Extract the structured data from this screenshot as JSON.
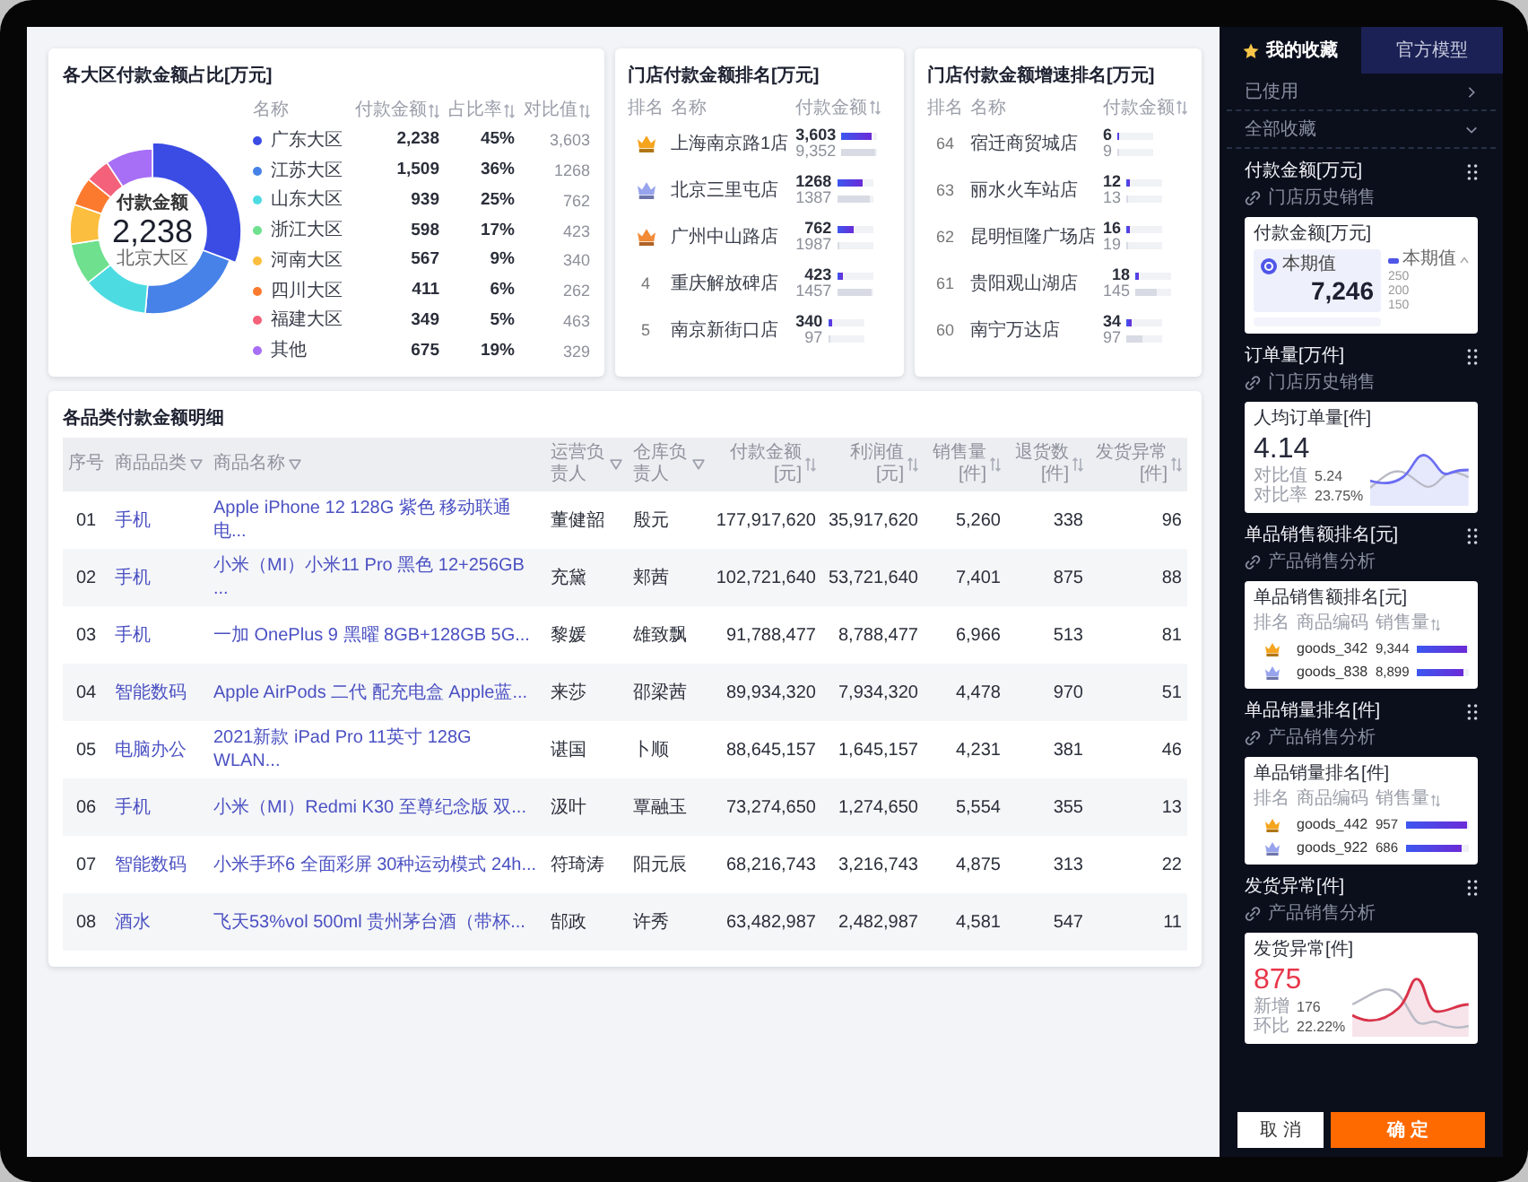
{
  "region_share": {
    "title": "各大区付款金额占比[万元]",
    "center": {
      "label": "付款金额",
      "value": "2,238",
      "caption": "北京大区"
    },
    "columns": [
      {
        "label": "名称",
        "sortable": false
      },
      {
        "label": "付款金额",
        "sortable": true
      },
      {
        "label": "占比率",
        "sortable": true
      },
      {
        "label": "对比值",
        "sortable": true
      }
    ],
    "rows": [
      {
        "color": "#3b4ce4",
        "amount": "2,238",
        "share": "45%",
        "compare": "3,603"
      },
      {
        "color": "#4682e8",
        "amount": "1,509",
        "share": "36%",
        "compare": "1268"
      },
      {
        "color": "#4ddbe2",
        "amount": "939",
        "share": "25%",
        "compare": "762"
      },
      {
        "color": "#6ee08e",
        "amount": "598",
        "share": "17%",
        "compare": "423"
      },
      {
        "color": "#fcbe3e",
        "amount": "567",
        "share": "9%",
        "compare": "340"
      },
      {
        "color": "#fb7a2e",
        "amount": "411",
        "share": "6%",
        "compare": "262"
      },
      {
        "color": "#f4617a",
        "amount": "349",
        "share": "5%",
        "compare": "463"
      },
      {
        "color": "#a76ef6",
        "amount": "675",
        "share": "19%",
        "compare": "329"
      }
    ],
    "slices": [
      {
        "color": "#3b4ce4",
        "selected": true
      },
      {
        "color": "#4682e8",
        "selected": false
      },
      {
        "color": "#4ddbe2",
        "selected": false
      },
      {
        "color": "#6ee08e",
        "selected": false
      },
      {
        "color": "#fcbe3e",
        "selected": false
      },
      {
        "color": "#fb7a2e",
        "selected": false
      },
      {
        "color": "#f4617a",
        "selected": false
      },
      {
        "color": "#a76ef6",
        "selected": false
      }
    ],
    "chart_data": {
      "type": "donut",
      "categories": [
        "广东大区",
        "江苏大区",
        "山东大区",
        "浙江大区",
        "河南大区",
        "四川大区",
        "福建大区",
        "其他"
      ],
      "values": [
        30.7,
        20.7,
        12.9,
        8.2,
        7.8,
        5.6,
        4.8,
        9.3
      ]
    }
  },
  "store_ranking": {
    "title": "门店付款金额排名[万元]",
    "columns": [
      {
        "label": "排名",
        "sortable": false
      },
      {
        "label": "名称",
        "sortable": false
      },
      {
        "label": "付款金额",
        "sortable": true
      }
    ],
    "rows": [
      {
        "kind": "medal",
        "color": "#f5a41d",
        "name": "上海南京路1店",
        "current": {
          "value": "3,603",
          "level": 0.85
        },
        "compare": {
          "value": "9,352",
          "level": 0.95
        }
      },
      {
        "kind": "medal",
        "color": "#97a3ec",
        "name": "北京三里屯店",
        "current": {
          "value": "1268",
          "level": 0.7
        },
        "compare": {
          "value": "1387",
          "level": 0.9
        }
      },
      {
        "kind": "medal",
        "color": "#f28a36",
        "name": "广州中山路店",
        "current": {
          "value": "762",
          "level": 0.45
        },
        "compare": {
          "value": "1987",
          "level": 0.05
        }
      },
      {
        "kind": "number",
        "rank": "4",
        "name": "重庆解放碑店",
        "current": {
          "value": "423",
          "level": 0.15
        },
        "compare": {
          "value": "1457",
          "level": 0.95
        }
      },
      {
        "kind": "number",
        "rank": "5",
        "name": "南京新街口店",
        "current": {
          "value": "340",
          "level": 0.12
        },
        "compare": {
          "value": "97",
          "level": 0.05
        }
      }
    ]
  },
  "store_growth_ranking": {
    "title": "门店付款金额增速排名[万元]",
    "columns": [
      {
        "label": "排名",
        "sortable": false
      },
      {
        "label": "名称",
        "sortable": false
      },
      {
        "label": "付款金额",
        "sortable": true
      }
    ],
    "rows": [
      {
        "kind": "number",
        "rank": "64",
        "name": "宿迁商贸城店",
        "current": {
          "value": "6",
          "level": 0.05
        },
        "compare": {
          "value": "9",
          "level": 0.04
        }
      },
      {
        "kind": "number",
        "rank": "63",
        "name": "丽水火车站店",
        "current": {
          "value": "12",
          "level": 0.08
        },
        "compare": {
          "value": "13",
          "level": 0.04
        }
      },
      {
        "kind": "number",
        "rank": "62",
        "name": "昆明恒隆广场店",
        "current": {
          "value": "16",
          "level": 0.1
        },
        "compare": {
          "value": "19",
          "level": 0.04
        }
      },
      {
        "kind": "number",
        "rank": "61",
        "name": "贵阳观山湖店",
        "current": {
          "value": "18",
          "level": 0.1
        },
        "compare": {
          "value": "145",
          "level": 0.6
        }
      },
      {
        "kind": "number",
        "rank": "60",
        "name": "南宁万达店",
        "current": {
          "value": "34",
          "level": 0.15
        },
        "compare": {
          "value": "97",
          "level": 0.45
        }
      }
    ]
  },
  "category_detail": {
    "title": "各品类付款金额明细",
    "columns": [
      {
        "label": "序号",
        "kind": "plain",
        "link": false
      },
      {
        "label": "商品品类",
        "kind": "filter",
        "link": true
      },
      {
        "label": "商品名称",
        "kind": "filter",
        "link": true
      },
      {
        "label": "运营负责人",
        "kind": "filter",
        "link": false
      },
      {
        "label": "仓库负责人",
        "kind": "filter",
        "link": false
      },
      {
        "label": "付款金额[元]",
        "kind": "sort",
        "link": false
      },
      {
        "label": "利润值[元]",
        "kind": "sort",
        "link": false
      },
      {
        "label": "销售量[件]",
        "kind": "sort",
        "link": false
      },
      {
        "label": "退货数[件]",
        "kind": "sort",
        "link": false
      },
      {
        "label": "发货异常[件]",
        "kind": "sort",
        "link": false
      }
    ],
    "rows": [
      [
        "01",
        "手机",
        "Apple iPhone 12 128G 紫色 移动联通电...",
        "董健韶",
        "殷元",
        "177,917,620",
        "35,917,620",
        "5,260",
        "338",
        "96"
      ],
      [
        "02",
        "手机",
        "小米（MI）小米11 Pro 黑色 12+256GB ...",
        "充黛",
        "郏茜",
        "102,721,640",
        "53,721,640",
        "7,401",
        "875",
        "88"
      ],
      [
        "03",
        "手机",
        "一加 OnePlus 9 黑曜 8GB+128GB 5G...",
        "黎媛",
        "雄致飘",
        "91,788,477",
        "8,788,477",
        "6,966",
        "513",
        "81"
      ],
      [
        "04",
        "智能数码",
        "Apple AirPods 二代 配充电盒 Apple蓝...",
        "来莎",
        "邵梁茜",
        "89,934,320",
        "7,934,320",
        "4,478",
        "970",
        "51"
      ],
      [
        "05",
        "电脑办公",
        "2021新款 iPad Pro 11英寸 128G WLAN...",
        "谌国",
        "卜顺",
        "88,645,157",
        "1,645,157",
        "4,231",
        "381",
        "46"
      ],
      [
        "06",
        "手机",
        "小米（MI）Redmi K30 至尊纪念版 双...",
        "汲叶",
        "覃融玉",
        "73,274,650",
        "1,274,650",
        "5,554",
        "355",
        "13"
      ],
      [
        "07",
        "智能数码",
        "小米手环6 全面彩屏 30种运动模式 24h...",
        "符琦涛",
        "阳元辰",
        "68,216,743",
        "3,216,743",
        "4,875",
        "313",
        "22"
      ],
      [
        "08",
        "酒水",
        "飞天53%vol 500ml 贵州茅台酒（带杯...",
        "郜政",
        "许秀",
        "63,482,987",
        "2,482,987",
        "4,581",
        "547",
        "11"
      ]
    ]
  },
  "sidebar": {
    "tabs": [
      {
        "label": "我的收藏",
        "kind": "favorites",
        "selected": true
      },
      {
        "label": "官方模型",
        "kind": "official",
        "selected": false
      }
    ],
    "groups": [
      {
        "label": "已使用",
        "expanded": false
      },
      {
        "label": "全部收藏",
        "expanded": true
      }
    ],
    "widgets": [
      {
        "title": "付款金额[万元]",
        "source": "门店历史销售",
        "preview": {
          "kind": "kpi",
          "title": "付款金额[万元]",
          "badge": "本期值",
          "value": "7,246",
          "legend": "本期值",
          "ticks": [
            "250",
            "200",
            "150"
          ]
        }
      },
      {
        "title": "订单量[万件]",
        "source": "门店历史销售",
        "preview": {
          "kind": "trend",
          "title": "人均订单量[件]",
          "value": "4.14",
          "stats": [
            {
              "label": "对比值",
              "value": "5.24"
            },
            {
              "label": "对比率",
              "value": "23.75%"
            }
          ]
        }
      },
      {
        "title": "单品销售额排名[元]",
        "source": "产品销售分析",
        "preview": {
          "kind": "ranking",
          "title": "单品销售额排名[元]",
          "columns": [
            {
              "label": "排名",
              "sortable": false
            },
            {
              "label": "商品编码",
              "sortable": false
            },
            {
              "label": "销售量",
              "sortable": true
            }
          ],
          "rows": [
            {
              "color": "#f5a41d",
              "code": "goods_342",
              "value": "9,344",
              "level": 0.96
            },
            {
              "color": "#97a3ec",
              "code": "goods_838",
              "value": "8,899",
              "level": 0.9
            }
          ]
        }
      },
      {
        "title": "单品销量排名[件]",
        "source": "产品销售分析",
        "preview": {
          "kind": "ranking",
          "title": "单品销量排名[件]",
          "columns": [
            {
              "label": "排名",
              "sortable": false
            },
            {
              "label": "商品编码",
              "sortable": false
            },
            {
              "label": "销售量",
              "sortable": true
            }
          ],
          "rows": [
            {
              "color": "#f5a41d",
              "code": "goods_442",
              "value": "957",
              "level": 0.96
            },
            {
              "color": "#97a3ec",
              "code": "goods_922",
              "value": "686",
              "level": 0.9
            }
          ]
        }
      },
      {
        "title": "发货异常[件]",
        "source": "产品销售分析",
        "preview": {
          "kind": "alert",
          "title": "发货异常[件]",
          "value": "875",
          "stats": [
            {
              "label": "新增",
              "value": "176"
            },
            {
              "label": "环比",
              "value": "22.22%"
            }
          ]
        }
      }
    ],
    "buttons": [
      {
        "label": "取 消",
        "kind": "secondary"
      },
      {
        "label": "确 定",
        "kind": "primary"
      }
    ]
  }
}
